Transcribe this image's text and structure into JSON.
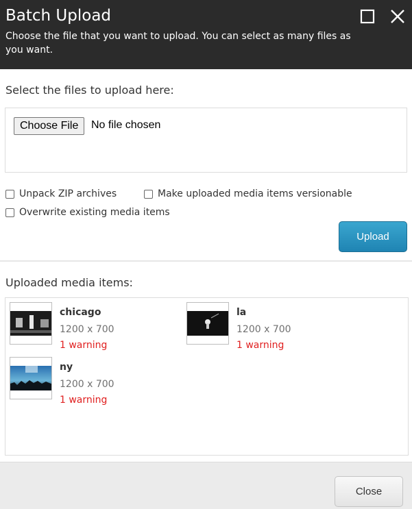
{
  "dialog": {
    "title": "Batch Upload",
    "subtitle": "Choose the file that you want to upload. You can select as many files as you want.",
    "maximize_icon": "maximize-icon",
    "close_icon": "close-icon"
  },
  "upload_section": {
    "label": "Select the files to upload here:",
    "choose_file_label": "Choose File",
    "no_file_text": "No file chosen"
  },
  "options": {
    "unpack_zip": {
      "label": "Unpack ZIP archives",
      "checked": false
    },
    "versionable": {
      "label": "Make uploaded media items versionable",
      "checked": false
    },
    "overwrite": {
      "label": "Overwrite existing media items",
      "checked": false
    }
  },
  "upload_button": {
    "label": "Upload",
    "color": "#2791c0"
  },
  "media": {
    "label": "Uploaded media items:",
    "items": [
      {
        "name": "chicago",
        "dims": "1200 x 700",
        "warning": "1 warning"
      },
      {
        "name": "la",
        "dims": "1200 x 700",
        "warning": "1 warning"
      },
      {
        "name": "ny",
        "dims": "1200 x 700",
        "warning": "1 warning"
      }
    ]
  },
  "footer": {
    "close_label": "Close"
  },
  "colors": {
    "header_bg": "#2b2b2b",
    "warning": "#e01f1f",
    "accent": "#2791c0"
  }
}
